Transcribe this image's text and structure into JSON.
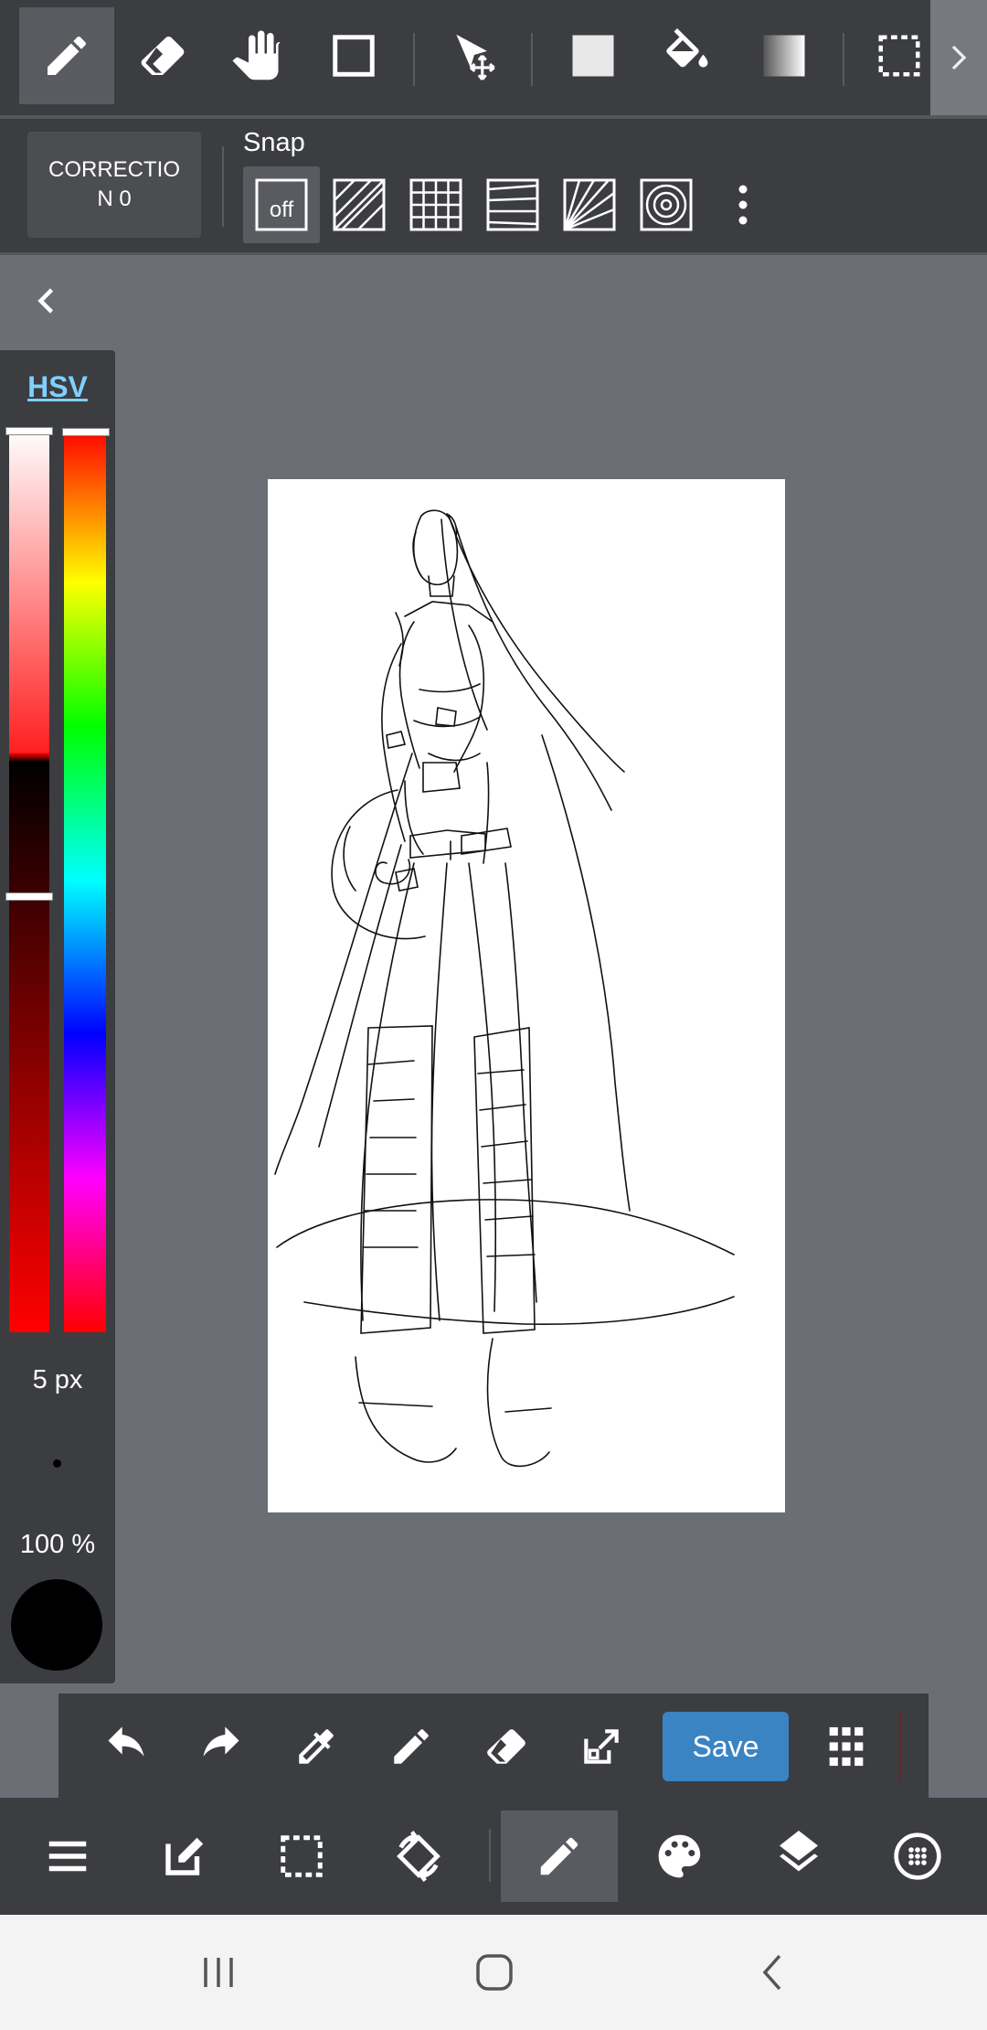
{
  "top_toolbar": {
    "tools": [
      {
        "icon": "pen-icon",
        "active": true
      },
      {
        "icon": "eraser-icon"
      },
      {
        "icon": "hand-icon"
      },
      {
        "icon": "rectangle-icon"
      },
      {
        "icon": "move-transform-icon"
      },
      {
        "icon": "fill-rect-icon"
      },
      {
        "icon": "bucket-icon"
      },
      {
        "icon": "gradient-icon"
      },
      {
        "icon": "selection-icon"
      }
    ]
  },
  "snap_bar": {
    "correction_label": "CORRECTION 0",
    "snap_label": "Snap",
    "snap_off_label": "off",
    "snap_options": [
      "off",
      "parallel-line",
      "grid",
      "perspective",
      "radial",
      "concentric-circle"
    ]
  },
  "color_panel": {
    "mode_label": "HSV",
    "brush_size": "5 px",
    "opacity": "100 %",
    "current_color": "#000000"
  },
  "action_bar": {
    "save_label": "Save",
    "actions": [
      "undo-icon",
      "redo-icon",
      "eyedropper-icon",
      "pen-icon",
      "eraser-icon",
      "export-icon",
      "Save",
      "grid-icon"
    ]
  },
  "bottom_nav": {
    "items": [
      "menu-icon",
      "edit-icon",
      "selection-icon",
      "rotate-icon",
      "pen-icon",
      "palette-icon",
      "layers-icon",
      "materials-icon"
    ],
    "active": "pen-icon"
  },
  "colors": {
    "toolbar_bg": "#3c3d41",
    "canvas_bg": "#6b6e75",
    "accent": "#3a84c4",
    "hsv_link": "#7fd0ff"
  }
}
